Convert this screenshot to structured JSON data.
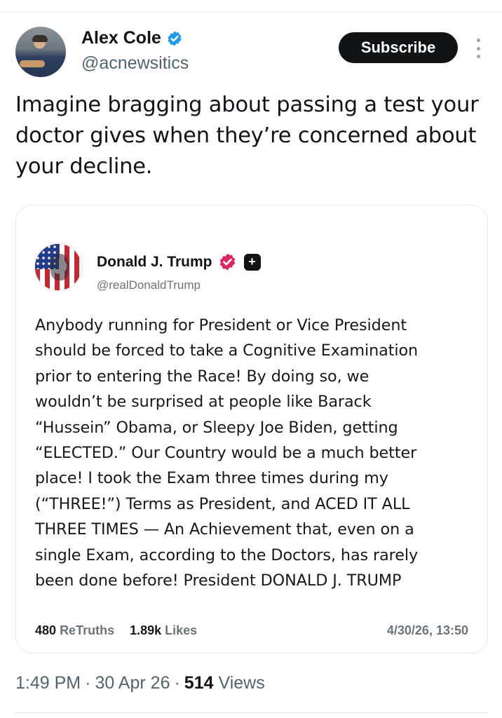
{
  "author": {
    "name": "Alex Cole",
    "handle": "@acnewsitics",
    "badge_icon": "verified-badge-icon",
    "badge_color": "#1d9bf0"
  },
  "actions": {
    "subscribe_label": "Subscribe",
    "more_icon": "more-vertical-icon"
  },
  "tweet": {
    "lines": [
      "Imagine bragging about passing a test your",
      "doctor gives when they’re concerned about",
      "your decline."
    ]
  },
  "quoted_post": {
    "name": "Donald J. Trump",
    "handle": "@realDonaldTrump",
    "badge_color": "#e0245e",
    "plus_label": "+",
    "lines": [
      "Anybody running for President or Vice President",
      "should be forced to take a Cognitive Examination",
      "prior to entering the Race! By doing so, we",
      "wouldn’t be surprised at people like Barack",
      "“Hussein” Obama, or Sleepy Joe Biden, getting",
      "“ELECTED.” Our Country would be a much better",
      "place! I took the Exam three times during my",
      "(“THREE!”) Terms as President, and ACED IT ALL",
      "THREE TIMES — An Achievement that, even on a",
      "single Exam, according to the Doctors, has rarely",
      "been done before! President DONALD J. TRUMP"
    ],
    "retruths_count": "480",
    "retruths_label": "ReTruths",
    "likes_count": "1.89k",
    "likes_label": "Likes",
    "date": "4/30/26, 13:50"
  },
  "meta": {
    "time": "1:49 PM",
    "date": "30 Apr 26",
    "separator": "·",
    "views_count": "514",
    "views_label": "Views"
  }
}
